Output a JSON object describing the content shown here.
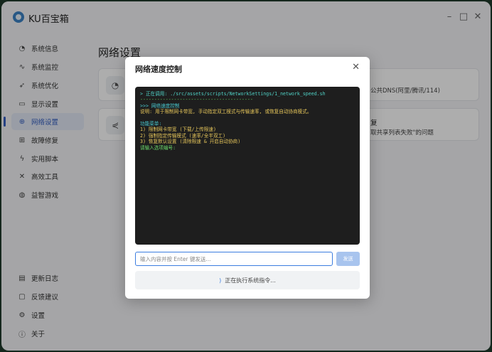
{
  "app": {
    "title": "KU百宝箱",
    "minimize": "–",
    "maximize": "□",
    "close": "✕"
  },
  "sidebar": {
    "items": [
      {
        "label": "系统信息",
        "icon": "dashboard-icon",
        "glyph": "◔"
      },
      {
        "label": "系统监控",
        "icon": "pulse-icon",
        "glyph": "∿"
      },
      {
        "label": "系统优化",
        "icon": "rocket-icon",
        "glyph": "➶"
      },
      {
        "label": "显示设置",
        "icon": "monitor-icon",
        "glyph": "▭"
      },
      {
        "label": "网络设置",
        "icon": "globe-icon",
        "glyph": "⊕"
      },
      {
        "label": "故障修复",
        "icon": "toolbox-icon",
        "glyph": "⊞"
      },
      {
        "label": "实用脚本",
        "icon": "lightning-icon",
        "glyph": "ϟ"
      },
      {
        "label": "高效工具",
        "icon": "tools-icon",
        "glyph": "✕"
      },
      {
        "label": "益智游戏",
        "icon": "gamepad-icon",
        "glyph": "◍"
      }
    ],
    "bottom_items": [
      {
        "label": "更新日志",
        "icon": "document-icon",
        "glyph": "▤"
      },
      {
        "label": "反馈建议",
        "icon": "chat-icon",
        "glyph": "▢"
      },
      {
        "label": "设置",
        "icon": "gear-icon",
        "glyph": "⚙"
      },
      {
        "label": "关于",
        "icon": "info-icon",
        "glyph": "ⓘ"
      }
    ],
    "active_index": 4
  },
  "main": {
    "page_title": "网络设置",
    "card1_text": "公共DNS(阿里/腾讯/114)",
    "card2_title": "复",
    "card2_desc": "取共享列表失败\"的问题"
  },
  "modal": {
    "title": "网络速度控制",
    "close_glyph": "✕",
    "terminal_lines": [
      {
        "cls": "t-cmd",
        "text": "> 正在调用: ./src/assets/scripts/NetworkSettings/1_network_speed.sh"
      },
      {
        "cls": "t-sep",
        "text": "----------------------------------------"
      },
      {
        "cls": "t-cyan",
        "text": ">>> 网络速度控制"
      },
      {
        "cls": "t-yellow",
        "text": "说明: 用于限制网卡带宽, 手动指定双工模式与传输速率, 或恢复自动协商模式。"
      },
      {
        "cls": "t-green",
        "text": " "
      },
      {
        "cls": "t-cyan",
        "text": "功能菜单:"
      },
      {
        "cls": "t-yellow",
        "text": "1) 限制网卡带宽 (下载/上传限速)"
      },
      {
        "cls": "t-yellow",
        "text": "2) 强制指定传输模式 (速率/全半双工)"
      },
      {
        "cls": "t-yellow",
        "text": "3) 恢复默认设置 (清除限速 & 开启自动协商)"
      },
      {
        "cls": "t-green",
        "text": "请输入选项编号:"
      }
    ],
    "input_placeholder": "输入内容并按 Enter 键发送...",
    "send_label": "发送",
    "status_text": "正在执行系统指令...",
    "status_glyph": ")"
  },
  "colors": {
    "accent": "#3761c2",
    "terminal_bg": "#1e1e1e",
    "terminal_green": "#5fd35f",
    "terminal_yellow": "#e5c55a"
  }
}
